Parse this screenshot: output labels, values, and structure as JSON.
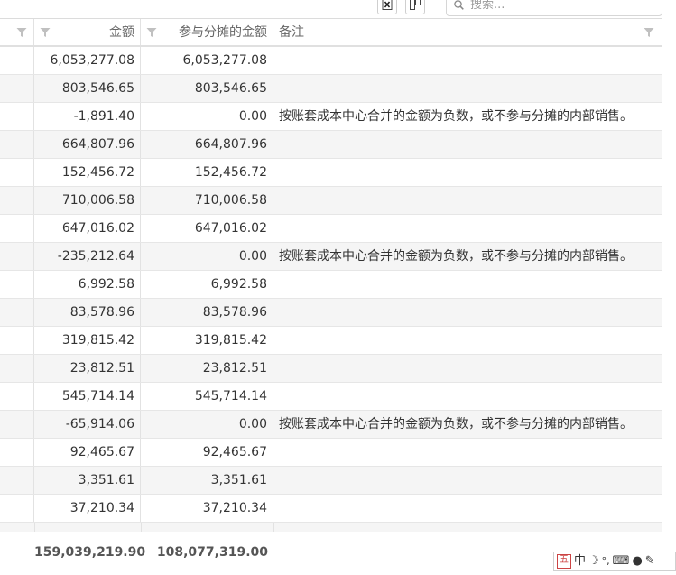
{
  "toolbar": {
    "export_icon": "excel-export-icon",
    "columns_icon": "column-chooser-icon",
    "search_placeholder": "搜索..."
  },
  "columns": {
    "amount": "金额",
    "allocated_amount": "参与分摊的金额",
    "remark": "备注"
  },
  "rows": [
    {
      "amount": "6,053,277.08",
      "allocated": "6,053,277.08",
      "remark": ""
    },
    {
      "amount": "803,546.65",
      "allocated": "803,546.65",
      "remark": ""
    },
    {
      "amount": "-1,891.40",
      "allocated": "0.00",
      "remark": "按账套成本中心合并的金额为负数，或不参与分摊的内部销售。"
    },
    {
      "amount": "664,807.96",
      "allocated": "664,807.96",
      "remark": ""
    },
    {
      "amount": "152,456.72",
      "allocated": "152,456.72",
      "remark": ""
    },
    {
      "amount": "710,006.58",
      "allocated": "710,006.58",
      "remark": ""
    },
    {
      "amount": "647,016.02",
      "allocated": "647,016.02",
      "remark": ""
    },
    {
      "amount": "-235,212.64",
      "allocated": "0.00",
      "remark": "按账套成本中心合并的金额为负数，或不参与分摊的内部销售。"
    },
    {
      "amount": "6,992.58",
      "allocated": "6,992.58",
      "remark": ""
    },
    {
      "amount": "83,578.96",
      "allocated": "83,578.96",
      "remark": ""
    },
    {
      "amount": "319,815.42",
      "allocated": "319,815.42",
      "remark": ""
    },
    {
      "amount": "23,812.51",
      "allocated": "23,812.51",
      "remark": ""
    },
    {
      "amount": "545,714.14",
      "allocated": "545,714.14",
      "remark": ""
    },
    {
      "amount": "-65,914.06",
      "allocated": "0.00",
      "remark": "按账套成本中心合并的金额为负数，或不参与分摊的内部销售。"
    },
    {
      "amount": "92,465.67",
      "allocated": "92,465.67",
      "remark": ""
    },
    {
      "amount": "3,351.61",
      "allocated": "3,351.61",
      "remark": ""
    },
    {
      "amount": "37,210.34",
      "allocated": "37,210.34",
      "remark": ""
    }
  ],
  "totals": {
    "amount": "159,039,219.90",
    "allocated": "108,077,319.00"
  },
  "ime": {
    "mode": "中"
  }
}
